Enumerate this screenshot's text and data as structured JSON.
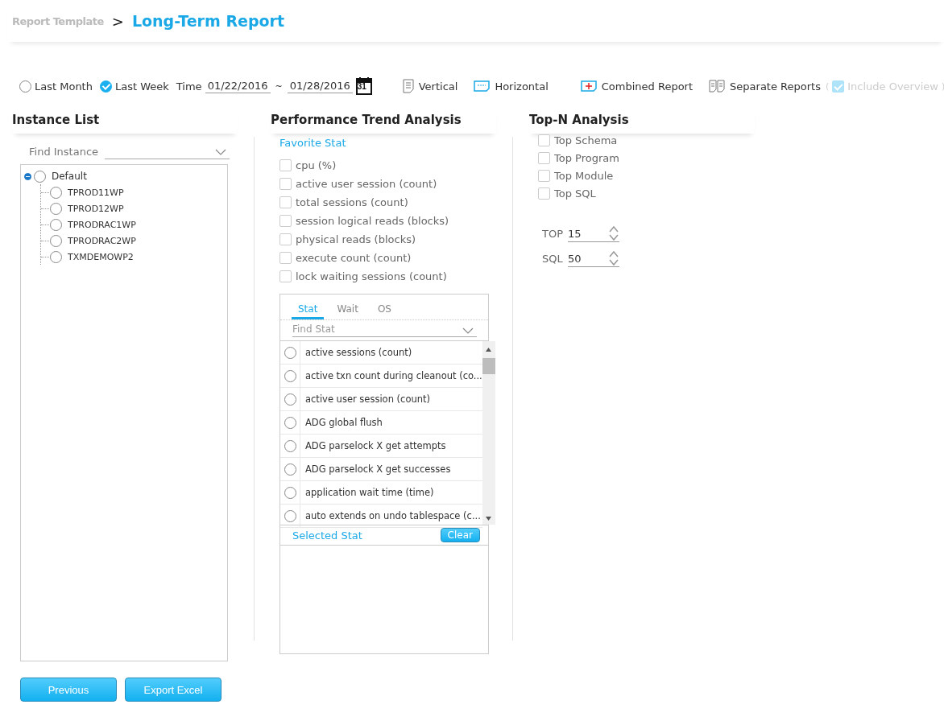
{
  "breadcrumb": {
    "parent": "Report Template",
    "separator": ">",
    "current": "Long-Term Report"
  },
  "toolbar": {
    "periods": [
      {
        "label": "Last Month",
        "selected": false
      },
      {
        "label": "Last Week",
        "selected": true
      }
    ],
    "time_label": "Time",
    "date_from": "01/22/2016",
    "date_sep": "~",
    "date_to": "01/28/2016",
    "calendar_day": "31",
    "layouts": [
      {
        "label": "Vertical",
        "kind": "vertical",
        "selected": false
      },
      {
        "label": "Horizontal",
        "kind": "horizontal",
        "selected": true
      }
    ],
    "reports": [
      {
        "label": "Combined Report",
        "kind": "combined",
        "selected": true
      },
      {
        "label": "Separate Reports",
        "kind": "separate",
        "selected": false
      }
    ],
    "include_overview": {
      "open": "(",
      "label": "Include Overview",
      "close": ")",
      "checked": true,
      "disabled": true
    }
  },
  "instance_list": {
    "title": "Instance List",
    "search_placeholder": "Find Instance",
    "tree": [
      {
        "label": "Default",
        "expanded": true,
        "selected": false,
        "children": [
          {
            "label": "TPROD11WP",
            "selected": false
          },
          {
            "label": "TPROD12WP",
            "selected": false
          },
          {
            "label": "TPRODRAC1WP",
            "selected": false
          },
          {
            "label": "TPRODRAC2WP",
            "selected": false
          },
          {
            "label": "TXMDEMOWP2",
            "selected": false
          }
        ]
      }
    ]
  },
  "performance": {
    "title": "Performance Trend Analysis",
    "favorite_title": "Favorite Stat",
    "favorites": [
      {
        "label": "cpu (%)",
        "checked": false
      },
      {
        "label": "active user session (count)",
        "checked": false
      },
      {
        "label": "total sessions (count)",
        "checked": false
      },
      {
        "label": "session logical reads (blocks)",
        "checked": false
      },
      {
        "label": "physical reads (blocks)",
        "checked": false
      },
      {
        "label": "execute count (count)",
        "checked": false
      },
      {
        "label": "lock waiting sessions (count)",
        "checked": false
      }
    ],
    "tabs": [
      {
        "label": "Stat",
        "selected": true
      },
      {
        "label": "Wait",
        "selected": false
      },
      {
        "label": "OS",
        "selected": false
      }
    ],
    "search_placeholder": "Find Stat",
    "stats": [
      {
        "label": "active sessions (count)",
        "selected": false
      },
      {
        "label": "active txn count during cleanout (co...",
        "selected": false
      },
      {
        "label": "active user session (count)",
        "selected": false
      },
      {
        "label": "ADG global flush",
        "selected": false
      },
      {
        "label": "ADG parselock X get attempts",
        "selected": false
      },
      {
        "label": "ADG parselock X get successes",
        "selected": false
      },
      {
        "label": "application wait time (time)",
        "selected": false
      },
      {
        "label": "auto extends on undo tablespace (c...",
        "selected": false
      }
    ],
    "selected_title": "Selected Stat",
    "clear_button": "Clear"
  },
  "top_n": {
    "title": "Top-N Analysis",
    "options": [
      {
        "label": "Top Schema",
        "checked": false
      },
      {
        "label": "Top Program",
        "checked": false
      },
      {
        "label": "Top Module",
        "checked": false
      },
      {
        "label": "Top SQL",
        "checked": false
      }
    ],
    "spinners": [
      {
        "label": "TOP",
        "value": "15"
      },
      {
        "label": "SQL",
        "value": "50"
      }
    ]
  },
  "buttons": [
    "Previous",
    "Export Excel"
  ]
}
